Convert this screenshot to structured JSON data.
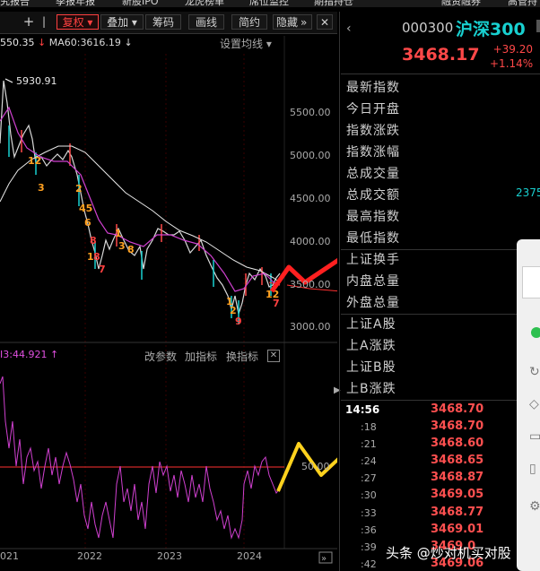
{
  "top_menu": [
    "究报告",
    "季报年报",
    "新股IPO",
    "龙虎榜单",
    "席位监控",
    "期指持仓",
    "融资融券",
    "高管持"
  ],
  "toolbar": {
    "items": [
      "+",
      "|",
      "复权",
      "叠加",
      "筹码",
      "画线",
      "简约",
      "隐藏"
    ],
    "more": "»"
  },
  "ma_legend": {
    "ma5": "550.35",
    "ma60": "MA60:3616.19"
  },
  "set_line_label": "设置均线",
  "peak_label": "5930.91",
  "price_ticks": [
    "5500.00",
    "5000.00",
    "4500.00",
    "4000.00",
    "3500.00",
    "3000.00"
  ],
  "indicator": {
    "label": "I3:44.921",
    "level_label": "50.00",
    "buttons": [
      "改参数",
      "加指标",
      "换指标"
    ]
  },
  "years": [
    "021",
    "2022",
    "2023",
    "2024"
  ],
  "quote": {
    "code": "000300",
    "name": "沪深300",
    "price": "3468.17",
    "change": "+39.20",
    "change_pct": "+1.14%"
  },
  "info_labels": [
    "最新指数",
    "今日开盘",
    "指数涨跌",
    "指数涨幅",
    "总成交量",
    "总成交额",
    "最高指数",
    "最低指数",
    "上证换手",
    "内盘总量",
    "外盘总量",
    "上证A股",
    "上A涨跌",
    "上证B股",
    "上B涨跌"
  ],
  "side_value": "2375",
  "ticks": {
    "time": "14:56",
    "rows": [
      {
        "t": ":18",
        "p": "3468.70"
      },
      {
        "t": ":21",
        "p": "3468.60"
      },
      {
        "t": ":24",
        "p": "3468.65"
      },
      {
        "t": ":27",
        "p": "3468.87"
      },
      {
        "t": ":30",
        "p": "3469.05"
      },
      {
        "t": ":33",
        "p": "3468.77"
      },
      {
        "t": ":36",
        "p": "3469.01"
      },
      {
        "t": ":39",
        "p": "3469.0"
      },
      {
        "t": ":42",
        "p": "3469.06"
      }
    ],
    "first_price": "3468.70"
  },
  "watermark": "头条 @炒对机买对股",
  "colors": {
    "up": "#ff4848",
    "down": "#18d0d0",
    "ma": "#d040d0",
    "accent": "#ffd21e"
  }
}
